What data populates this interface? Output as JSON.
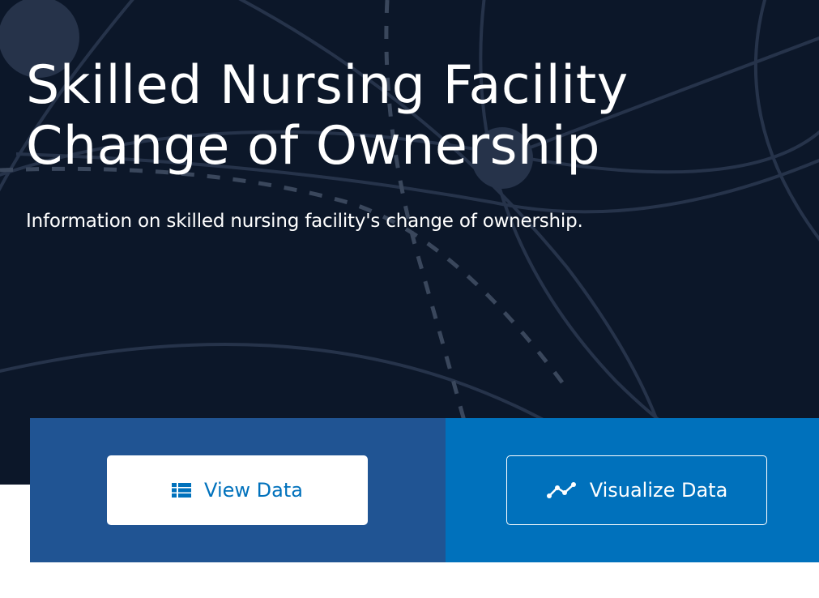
{
  "hero": {
    "title_line1": "Skilled Nursing Facility",
    "title_line2": "Change of Ownership",
    "subtitle": "Information on skilled nursing facility's change of ownership."
  },
  "actions": {
    "view_data_label": "View Data",
    "view_data_icon": "table-icon",
    "visualize_data_label": "Visualize Data",
    "visualize_data_icon": "line-chart-icon"
  },
  "colors": {
    "hero_background": "#0c1729",
    "panel_left": "#205493",
    "panel_right": "#0071bc",
    "button_text_primary": "#0071bc",
    "text_light": "#ffffff"
  }
}
